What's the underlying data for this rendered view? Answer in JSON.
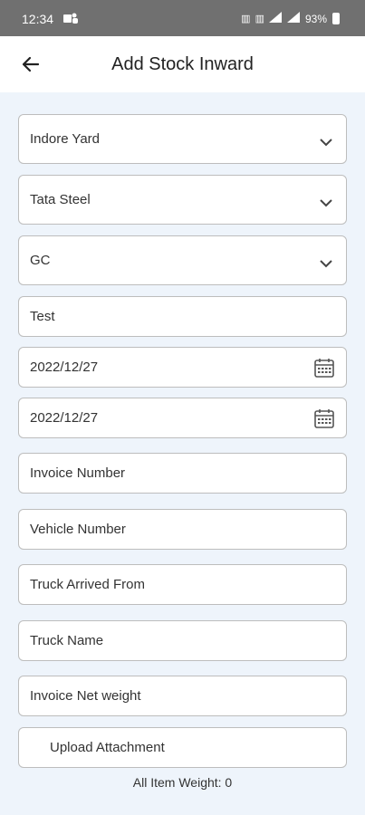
{
  "status_bar": {
    "time": "12:34",
    "battery": "93%",
    "icons": [
      "teams-icon",
      "volte-icon",
      "volte-icon",
      "signal-icon",
      "signal-icon",
      "battery-icon"
    ]
  },
  "app_bar": {
    "title": "Add Stock Inward",
    "back_icon": "arrow-left-icon"
  },
  "form": {
    "location_select": "Indore Yard",
    "supplier_select": "Tata Steel",
    "type_select": "GC",
    "remark_input": "Test",
    "date_1": "2022/12/27",
    "date_2": "2022/12/27",
    "invoice_number_placeholder": "Invoice Number",
    "vehicle_number_placeholder": "Vehicle Number",
    "truck_arrived_from_placeholder": "Truck Arrived From",
    "truck_name_placeholder": "Truck Name",
    "invoice_net_weight_placeholder": "Invoice Net weight",
    "upload_label": "Upload Attachment",
    "all_item_weight": "All Item Weight: 0"
  },
  "colors": {
    "status_bar_bg": "#707070",
    "app_bar_bg": "#ffffff",
    "page_bg": "#eef4fb",
    "field_border": "#bdbdbd"
  }
}
